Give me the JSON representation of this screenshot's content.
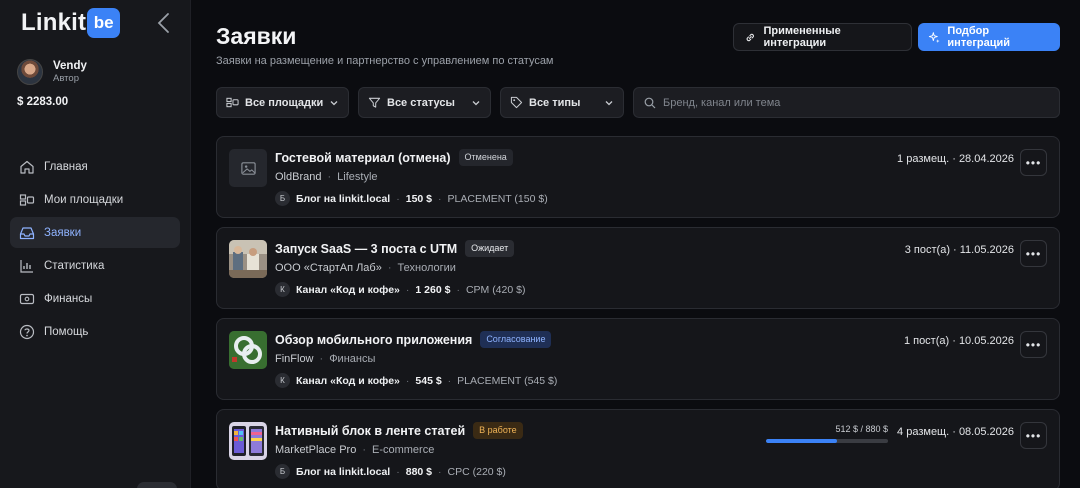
{
  "brand": {
    "name": "Linkit",
    "badge": "be"
  },
  "user": {
    "name": "Vendy",
    "role": "Автор",
    "balance": "$ 2283.00"
  },
  "nav": [
    {
      "label": "Главная",
      "icon": "home-icon",
      "active": false
    },
    {
      "label": "Мои площадки",
      "icon": "platforms-icon",
      "active": false
    },
    {
      "label": "Заявки",
      "icon": "inbox-icon",
      "active": true
    },
    {
      "label": "Статистика",
      "icon": "chart-icon",
      "active": false
    },
    {
      "label": "Финансы",
      "icon": "wallet-icon",
      "active": false
    },
    {
      "label": "Помощь",
      "icon": "help-icon",
      "active": false
    }
  ],
  "header": {
    "title": "Заявки",
    "subtitle": "Заявки на размещение и партнерство с управлением по статусам",
    "applied_label": "Примененные интеграции",
    "match_label": "Подбор интеграций"
  },
  "filters": {
    "platforms": "Все площадки",
    "statuses": "Все статусы",
    "types": "Все типы",
    "search_placeholder": "Бренд, канал или тема"
  },
  "colors": {
    "accent": "#3b82f6",
    "background": "#0b0c10",
    "card": "#15161a"
  },
  "requests": [
    {
      "title": "Гостевой материал (отмена)",
      "status": "Отменена",
      "status_style": "canceled",
      "brand": "OldBrand",
      "category": "Lifestyle",
      "channel_initial": "Б",
      "channel": "Блог на linkit.local",
      "price": "150 $",
      "type": "PLACEMENT (150 $)",
      "right": "1 размещ. · 28.04.2026",
      "more": "•••"
    },
    {
      "title": "Запуск SaaS — 3 поста с UTM",
      "status": "Ожидает",
      "status_style": "waiting",
      "brand": "ООО «СтартАп Лаб»",
      "category": "Технологии",
      "channel_initial": "К",
      "channel": "Канал «Код и кофе»",
      "price": "1 260 $",
      "type": "CPM (420 $)",
      "right": "3 пост(а) · 11.05.2026",
      "more": "•••"
    },
    {
      "title": "Обзор мобильного приложения",
      "status": "Согласование",
      "status_style": "approval",
      "brand": "FinFlow",
      "category": "Финансы",
      "channel_initial": "К",
      "channel": "Канал «Код и кофе»",
      "price": "545 $",
      "type": "PLACEMENT (545 $)",
      "right": "1 пост(а) · 10.05.2026",
      "more": "•••"
    },
    {
      "title": "Нативный блок в ленте статей",
      "status": "В работе",
      "status_style": "inwork",
      "brand": "MarketPlace Pro",
      "category": "E-commerce",
      "channel_initial": "Б",
      "channel": "Блог на linkit.local",
      "price": "880 $",
      "type": "CPC (220 $)",
      "right": "4 размещ. · 08.05.2026",
      "more": "•••",
      "progress_label": "512 $ / 880 $",
      "progress": 0.582
    }
  ]
}
